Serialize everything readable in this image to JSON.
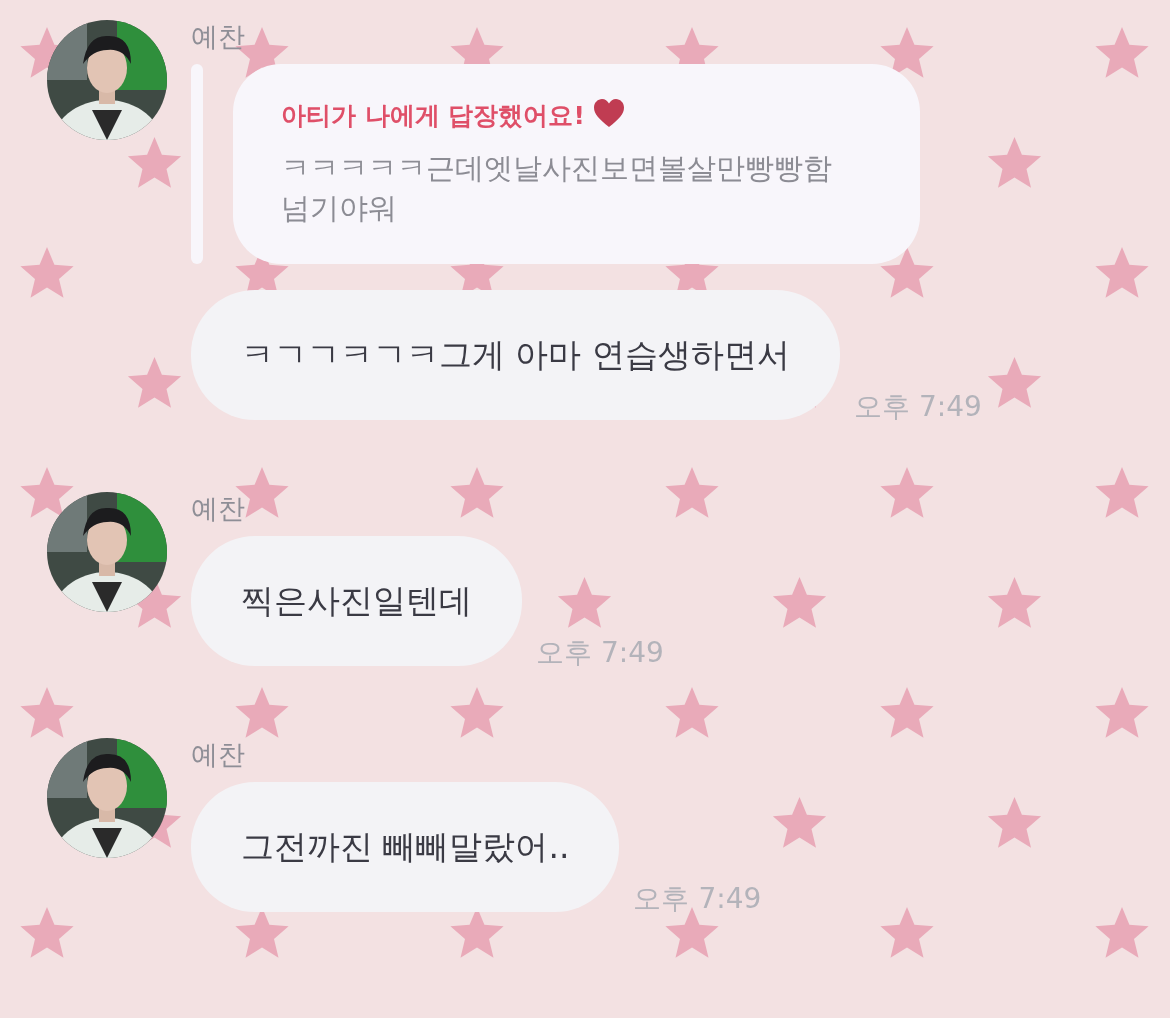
{
  "messages": [
    {
      "sender": "예찬",
      "avatar": {
        "kind": "picture"
      },
      "items": [
        {
          "kind": "reply_quote",
          "title": "아티가 나에게 답장했어요!",
          "text": "ㅋㅋㅋㅋㅋ근데엣날사진보면볼살만빵빵함 넘기야워"
        },
        {
          "kind": "text",
          "text": "ㅋㄱㄱㅋㄱㅋ그게 아마 연습생하면서",
          "time": "오후 7:49"
        }
      ]
    },
    {
      "sender": "예찬",
      "avatar": {
        "kind": "picture"
      },
      "items": [
        {
          "kind": "text",
          "text": "찍은사진일텐데",
          "time": "오후 7:49"
        }
      ]
    },
    {
      "sender": "예찬",
      "avatar": {
        "kind": "picture"
      },
      "items": [
        {
          "kind": "text",
          "text": "그전까진 빼빼말랐어..",
          "time": "오후 7:49"
        }
      ]
    }
  ]
}
